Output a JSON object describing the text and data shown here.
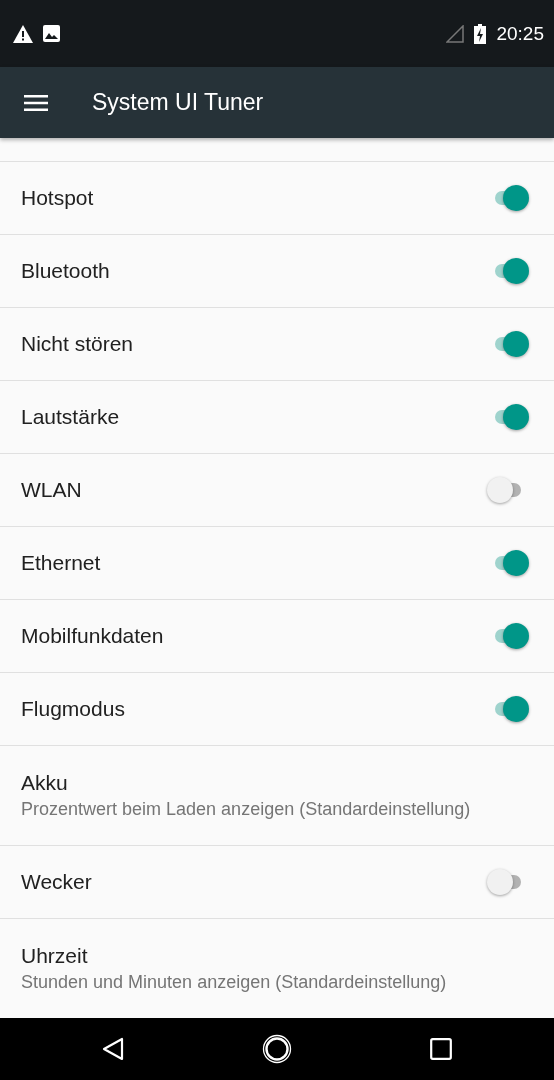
{
  "status_bar": {
    "time": "20:25"
  },
  "toolbar": {
    "title": "System UI Tuner"
  },
  "settings": [
    {
      "kind": "switch",
      "label": "Hotspot",
      "on": true
    },
    {
      "kind": "switch",
      "label": "Bluetooth",
      "on": true
    },
    {
      "kind": "switch",
      "label": "Nicht stören",
      "on": true
    },
    {
      "kind": "switch",
      "label": "Lautstärke",
      "on": true
    },
    {
      "kind": "switch",
      "label": "WLAN",
      "on": false
    },
    {
      "kind": "switch",
      "label": "Ethernet",
      "on": true
    },
    {
      "kind": "switch",
      "label": "Mobilfunkdaten",
      "on": true
    },
    {
      "kind": "switch",
      "label": "Flugmodus",
      "on": true
    },
    {
      "kind": "summary",
      "label": "Akku",
      "summary": "Prozentwert beim Laden anzeigen (Standardeinstellung)"
    },
    {
      "kind": "switch",
      "label": "Wecker",
      "on": false
    },
    {
      "kind": "summary",
      "label": "Uhrzeit",
      "summary": "Stunden und Minuten anzeigen (Standardeinstellung)"
    }
  ]
}
